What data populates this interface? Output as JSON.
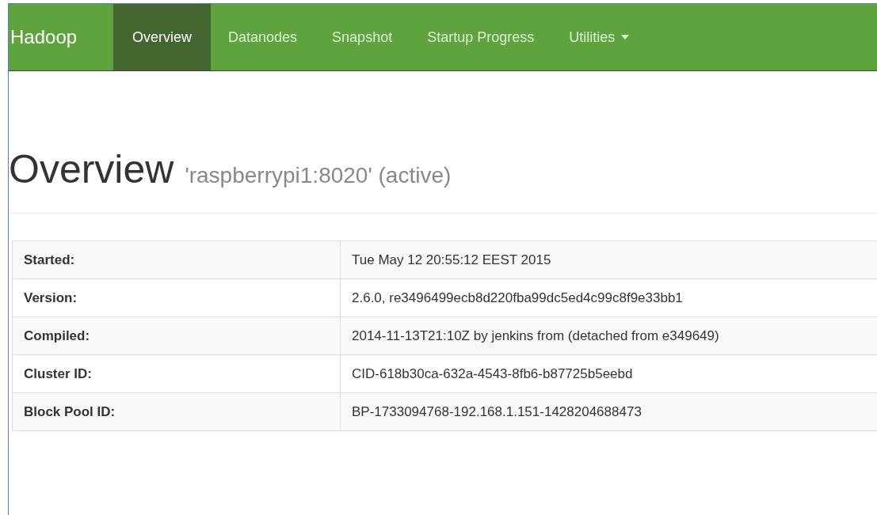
{
  "navbar": {
    "brand": "Hadoop",
    "tabs": [
      {
        "label": "Overview",
        "selected": true,
        "dropdown": false
      },
      {
        "label": "Datanodes",
        "selected": false,
        "dropdown": false
      },
      {
        "label": "Snapshot",
        "selected": false,
        "dropdown": false
      },
      {
        "label": "Startup Progress",
        "selected": false,
        "dropdown": false
      },
      {
        "label": "Utilities",
        "selected": false,
        "dropdown": true
      }
    ]
  },
  "heading": {
    "title": "Overview",
    "subtitle": "'raspberrypi1:8020' (active)"
  },
  "table": {
    "rows": [
      {
        "label": "Started:",
        "value": "Tue May 12 20:55:12 EEST 2015"
      },
      {
        "label": "Version:",
        "value": "2.6.0, re3496499ecb8d220fba99dc5ed4c99c8f9e33bb1"
      },
      {
        "label": "Compiled:",
        "value": "2014-11-13T21:10Z by jenkins from (detached from e349649)"
      },
      {
        "label": "Cluster ID:",
        "value": "CID-618b30ca-632a-4543-8fb6-b87725b5eebd"
      },
      {
        "label": "Block Pool ID:",
        "value": "BP-1733094768-192.168.1.151-1428204688473"
      }
    ]
  }
}
